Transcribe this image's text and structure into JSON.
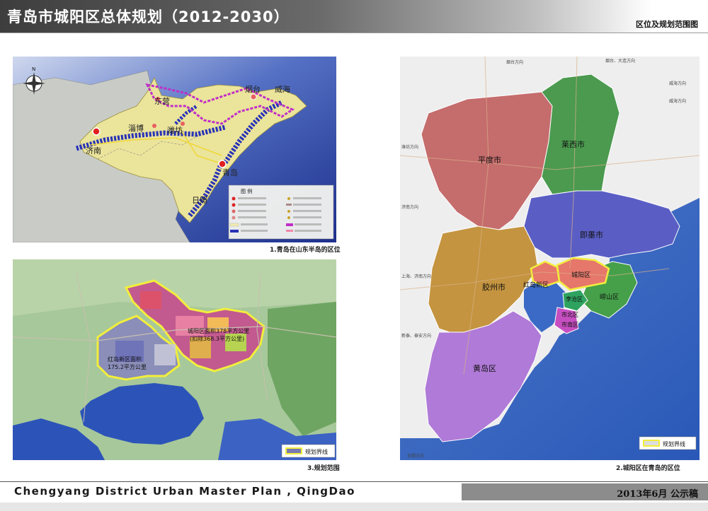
{
  "header": {
    "title": "青岛市城阳区总体规划（2012-2030）",
    "subtitle": "区位及规划范围图"
  },
  "panel1": {
    "caption": "1.青岛在山东半岛的区位",
    "cities": {
      "jinan": "济南",
      "zibo": "淄博",
      "dongying": "东营",
      "weifang": "潍坊",
      "yantai": "烟台",
      "weihai": "威海",
      "qingdao": "青岛",
      "rizhao": "日照"
    },
    "legend_title": "图 例"
  },
  "panel2": {
    "caption": "2.城阳区在青岛的区位",
    "districts": {
      "pingdu": "平度市",
      "laixi": "莱西市",
      "jimo": "即墨市",
      "jiaozhou": "胶州市",
      "chengyang": "城阳区",
      "hongdao": "红岛新区",
      "licang": "李沧区",
      "laoshan": "崂山区",
      "shibei": "市北区",
      "shinan": "市南区",
      "huangdao": "黄岛区"
    },
    "legend_label": "规划界线",
    "directions": {
      "top1": "烟台方向",
      "top2": "烟台、大连方向",
      "top3": "威海方向",
      "top4": "威海方向",
      "left1": "潍坊方向",
      "left2": "济南方向",
      "left3": "上海、济南方向",
      "left4": "新泰、泰安方向",
      "bottom1": "日照方向"
    }
  },
  "panel3": {
    "caption": "3.规划范围",
    "area_chengyang": "城阳区面积378平方公里",
    "area_chengyang2": "(扣除368.3平方公里)",
    "area_hongdao": "红岛新区面积",
    "area_hongdao2": "175.2平方公里",
    "legend_label": "规划界线"
  },
  "footer": {
    "english": "Chengyang District Urban Master Plan , QingDao",
    "date": "2013年6月  公示稿"
  },
  "colors": {
    "sea": "#2a45a8",
    "land_gray": "#c8cbc4",
    "shandong_yellow": "#e9e39a",
    "pingdu": "#c56c6c",
    "laixi": "#4b9a4f",
    "jimo": "#5a5ec4",
    "jiaozhou": "#c49440",
    "chengyang": "#e6776b",
    "huangdao": "#b07ad8",
    "outline": "#f2ee3c"
  }
}
